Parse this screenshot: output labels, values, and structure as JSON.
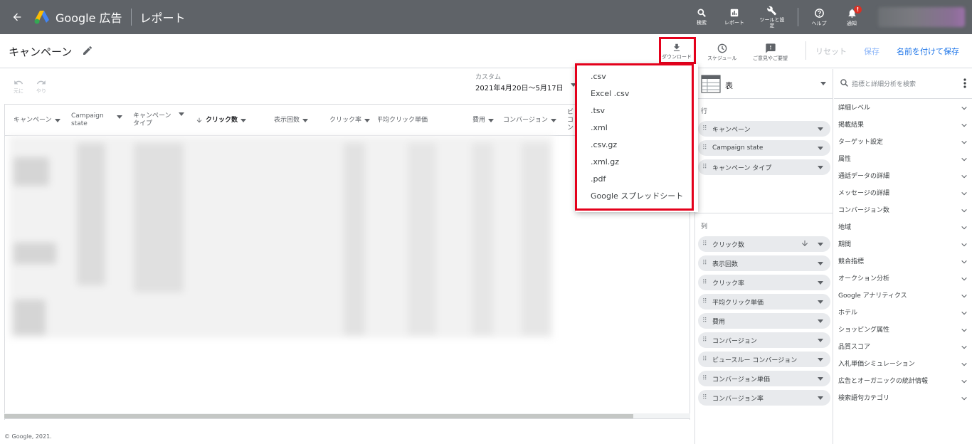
{
  "topbar": {
    "logo_text": "Google 広告",
    "title": "レポート",
    "actions": [
      {
        "label": "検索",
        "icon": "search-icon"
      },
      {
        "label": "レポート",
        "icon": "reports-icon"
      },
      {
        "label": "ツールと設定",
        "icon": "wrench-icon"
      },
      {
        "label": "ヘルプ",
        "icon": "help-icon"
      },
      {
        "label": "通知",
        "icon": "bell-icon",
        "badge": "!"
      }
    ]
  },
  "subbar": {
    "report_name": "キャンペーン",
    "download_label": "ダウンロード",
    "schedule_label": "スケジュール",
    "feedback_label": "ご意見やご要望",
    "reset_label": "リセット",
    "save_label": "保存",
    "save_as_label": "名前を付けて保存"
  },
  "toolbar": {
    "undo_label": "元に",
    "redo_label": "やり",
    "date_label": "カスタム",
    "date_value": "2021年4月20日～5月17日"
  },
  "table": {
    "headers": [
      {
        "label": "キャンペーン",
        "sortable": true
      },
      {
        "label": "Campaign state",
        "sortable": true
      },
      {
        "label": "キャンペーン タイプ",
        "sortable": true
      },
      {
        "label": "クリック数",
        "sortable": true,
        "sorted": "desc"
      },
      {
        "label": "表示回数",
        "sortable": true
      },
      {
        "label": "クリック率",
        "sortable": true
      },
      {
        "label": "平均クリック単価",
        "sortable": true
      },
      {
        "label": "費用",
        "sortable": true
      },
      {
        "label": "コンバージョン",
        "sortable": true
      },
      {
        "label": "ビ コン",
        "sortable": true
      }
    ]
  },
  "download_menu": {
    "items": [
      ".csv",
      "Excel .csv",
      ".tsv",
      ".xml",
      ".csv.gz",
      ".xml.gz",
      ".pdf",
      "Google スプレッドシート"
    ]
  },
  "editor": {
    "viz_label": "表",
    "rows_label": "行",
    "rows": [
      "キャンペーン",
      "Campaign state",
      "キャンペーン タイプ"
    ],
    "columns_label": "列",
    "columns": [
      "クリック数",
      "表示回数",
      "クリック率",
      "平均クリック単価",
      "費用",
      "コンバージョン",
      "ビュースルー コンバージョン",
      "コンバージョン単価",
      "コンバージョン率"
    ]
  },
  "metrics_panel": {
    "search_placeholder": "指標と詳細分析を検索",
    "categories": [
      "詳細レベル",
      "掲載結果",
      "ターゲット設定",
      "属性",
      "通話データの詳細",
      "メッセージの詳細",
      "コンバージョン数",
      "地域",
      "期間",
      "競合指標",
      "オークション分析",
      "Google アナリティクス",
      "ホテル",
      "ショッピング属性",
      "品質スコア",
      "入札単価シミュレーション",
      "広告とオーガニックの統計情報",
      "検索語句カテゴリ"
    ]
  },
  "footer": {
    "copyright": "© Google, 2021."
  },
  "colors": {
    "topbar_bg": "#5f6368",
    "highlight": "#e4001b",
    "link_blue": "#1a73e8"
  }
}
